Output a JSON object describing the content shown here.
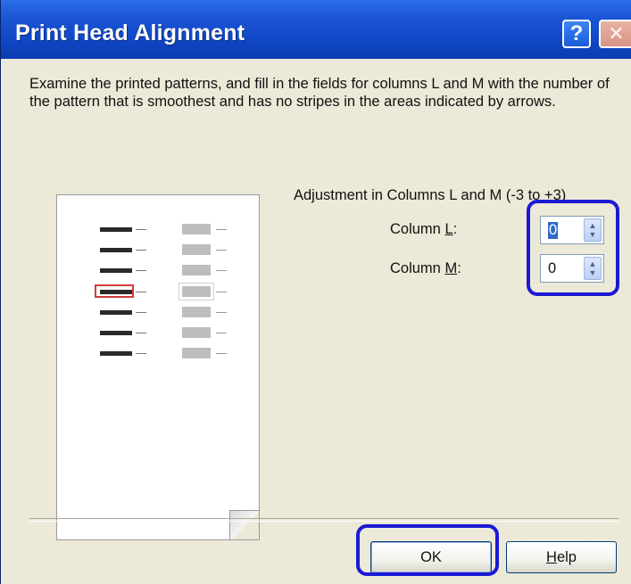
{
  "window": {
    "title": "Print Head Alignment",
    "help_glyph": "?",
    "close_glyph": "✕"
  },
  "instructions": "Examine the printed patterns, and fill in the fields for columns L and M with the number of the pattern that is smoothest and has no stripes in the areas indicated by arrows.",
  "adjustment": {
    "heading": "Adjustment in Columns L and M (-3 to +3)",
    "column_l": {
      "label_prefix": "Column ",
      "label_key": "L",
      "label_suffix": ":",
      "value": "0"
    },
    "column_m": {
      "label_prefix": "Column ",
      "label_key": "M",
      "label_suffix": ":",
      "value": "0"
    }
  },
  "preview": {
    "rows": 7,
    "highlighted_row": 4
  },
  "buttons": {
    "ok": "OK",
    "help_key": "H",
    "help_rest": "elp"
  },
  "colors": {
    "titlebar": "#0f46c4",
    "highlight_oval": "#1a1ad6",
    "selected_pattern": "#d33a3a"
  }
}
